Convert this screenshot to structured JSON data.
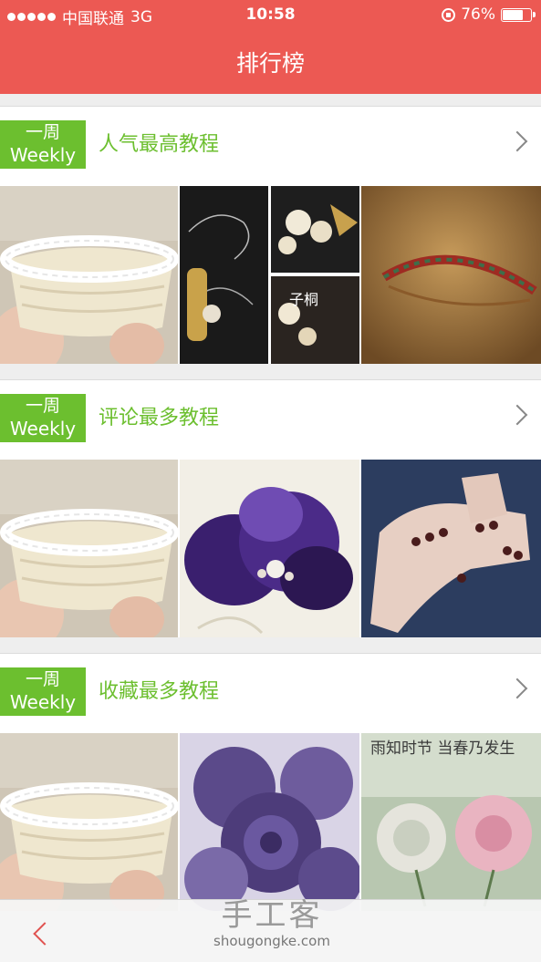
{
  "status_bar": {
    "carrier": "中国联通",
    "network": "3G",
    "time": "10:58",
    "battery": "76%",
    "battery_level": 0.76
  },
  "nav": {
    "title": "排行榜"
  },
  "sections": [
    {
      "badge_line1": "一周",
      "badge_line2": "Weekly",
      "title": "人气最高教程"
    },
    {
      "badge_line1": "一周",
      "badge_line2": "Weekly",
      "title": "评论最多教程"
    },
    {
      "badge_line1": "一周",
      "badge_line2": "Weekly",
      "title": "收藏最多教程"
    }
  ],
  "thumb_texts": {
    "sec1_thumb3": "子桐",
    "sec3_thumb3": "雨知时节 当春乃发生"
  },
  "watermark": {
    "line1": "手工客",
    "line2": "shougongke.com"
  },
  "colors": {
    "header_red": "#ec5953",
    "accent_green": "#6cbf2f"
  }
}
